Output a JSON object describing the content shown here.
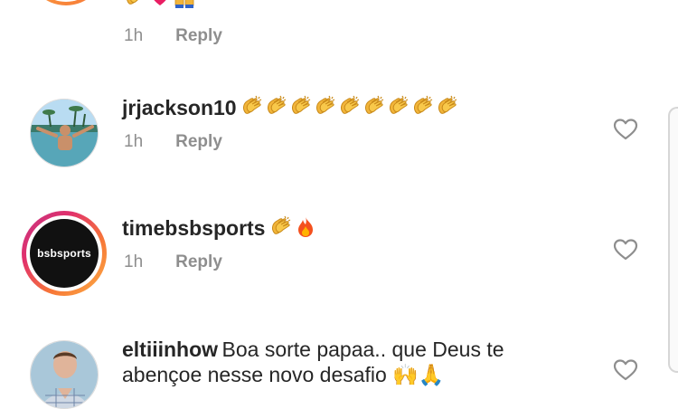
{
  "comments": [
    {
      "id": "prev",
      "time": "1h",
      "reply_label": "Reply",
      "icons": [
        "clap-emoji",
        "heart-emoji",
        "raised-hands-emoji"
      ]
    },
    {
      "id": "jrjackson10",
      "username": "jrjackson10",
      "text": "👏👏👏👏👏👏👏👏👏",
      "time": "1h",
      "reply_label": "Reply",
      "like_icon": "heart-outline-icon"
    },
    {
      "id": "timebsbsports",
      "username": "timebsbsports",
      "text": "👏🔥",
      "time": "1h",
      "reply_label": "Reply",
      "like_icon": "heart-outline-icon",
      "avatar_logo_text": "bsbsports",
      "story_ring": true
    },
    {
      "id": "eltiiinhow",
      "username": "eltiiinhow",
      "text_line1": "Boa sorte papaa.. que Deus te",
      "text_line2": "abençoe nesse novo desafio 🙌🙏",
      "like_icon": "heart-outline-icon"
    }
  ],
  "colors": {
    "username": "#262626",
    "meta": "#8e8e8e",
    "ring_gradient": [
      "#c13584",
      "#e1306c",
      "#f77737",
      "#fcaf45"
    ]
  }
}
